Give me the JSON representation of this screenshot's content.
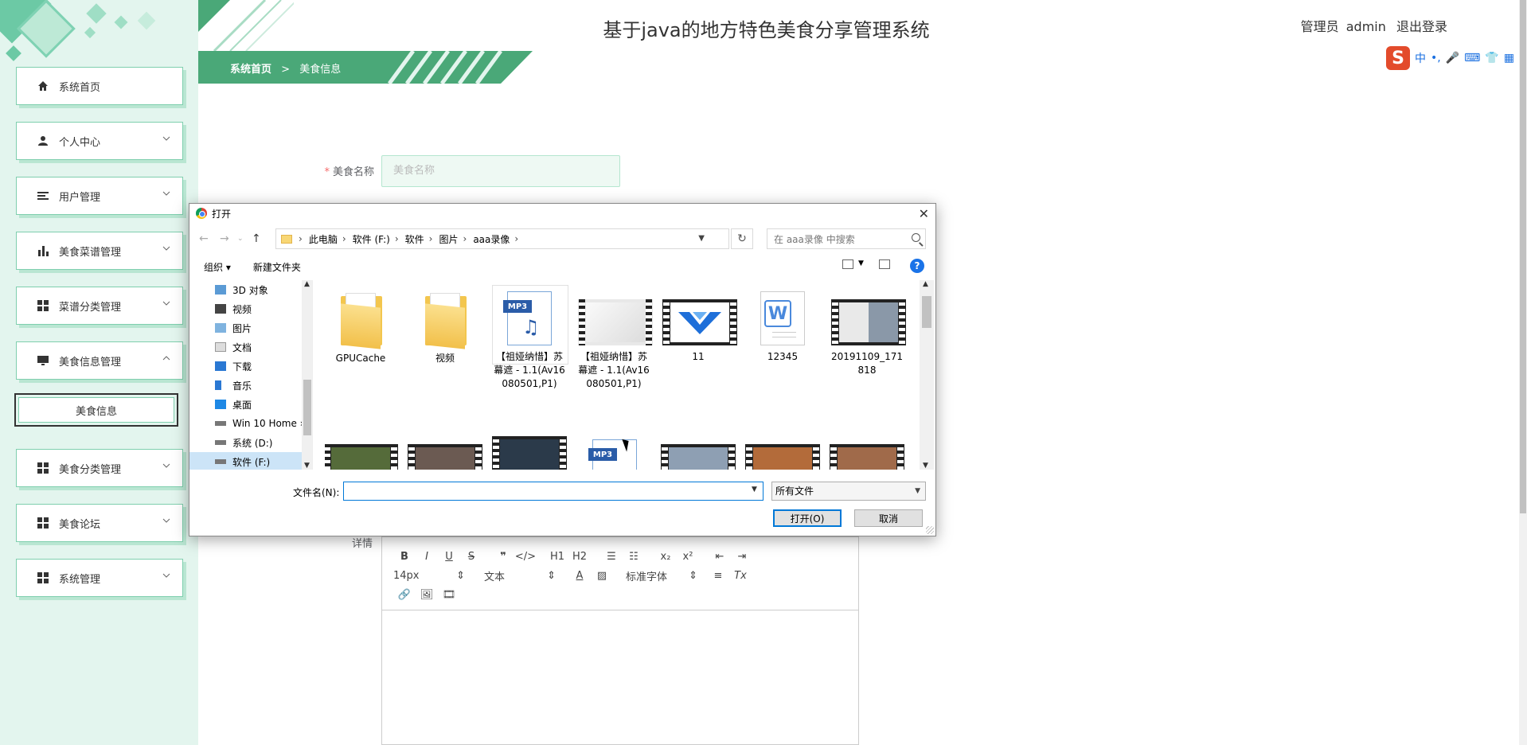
{
  "header": {
    "title": "基于java的地方特色美食分享管理系统",
    "user_role": "管理员",
    "user_name": "admin",
    "logout": "退出登录"
  },
  "breadcrumb": {
    "home": "系统首页",
    "separator": ">",
    "current": "美食信息"
  },
  "sidebar": {
    "items": [
      {
        "label": "系统首页",
        "icon": "home-icon"
      },
      {
        "label": "个人中心",
        "icon": "person-icon"
      },
      {
        "label": "用户管理",
        "icon": "list-icon"
      },
      {
        "label": "美食菜谱管理",
        "icon": "bar-chart-icon"
      },
      {
        "label": "菜谱分类管理",
        "icon": "grid-icon"
      },
      {
        "label": "美食信息管理",
        "icon": "monitor-icon"
      },
      {
        "label": "美食分类管理",
        "icon": "grid-icon"
      },
      {
        "label": "美食论坛",
        "icon": "grid-icon"
      },
      {
        "label": "系统管理",
        "icon": "grid-icon"
      }
    ],
    "sub_item": "美食信息"
  },
  "form": {
    "food_name_label": "美食名称",
    "food_name_placeholder": "美食名称",
    "detail_label": "详情"
  },
  "editor": {
    "font_size": "14px",
    "block_type": "文本",
    "font_family": "标准字体",
    "h1": "H1",
    "h2": "H2"
  },
  "ime": {
    "mode": "中"
  },
  "dialog": {
    "title": "打开",
    "path": [
      "此电脑",
      "软件 (F:)",
      "软件",
      "图片",
      "aaa录像"
    ],
    "search_placeholder": "在 aaa录像 中搜索",
    "organize": "组织",
    "new_folder": "新建文件夹",
    "nav_items": [
      {
        "label": "3D 对象",
        "icon": "cube-icon"
      },
      {
        "label": "视频",
        "icon": "video-icon"
      },
      {
        "label": "图片",
        "icon": "picture-icon"
      },
      {
        "label": "文档",
        "icon": "document-icon"
      },
      {
        "label": "下载",
        "icon": "download-icon"
      },
      {
        "label": "音乐",
        "icon": "music-icon"
      },
      {
        "label": "桌面",
        "icon": "desktop-icon"
      },
      {
        "label": "Win 10 Home ›",
        "icon": "drive-icon"
      },
      {
        "label": "系统 (D:)",
        "icon": "drive-icon"
      },
      {
        "label": "软件 (F:)",
        "icon": "drive-icon"
      }
    ],
    "files": [
      {
        "name": "GPUCache",
        "type": "folder"
      },
      {
        "name": "视频",
        "type": "folder"
      },
      {
        "name": "【祖娅纳惜】苏幕遮 - 1.1(Av16080501,P1)",
        "type": "mp3"
      },
      {
        "name": "【祖娅纳惜】苏幕遮 - 1.1(Av16080501,P1)",
        "type": "video"
      },
      {
        "name": "11",
        "type": "video"
      },
      {
        "name": "12345",
        "type": "doc"
      },
      {
        "name": "20191109_171818",
        "type": "video"
      }
    ],
    "filename_label": "文件名(N):",
    "filename_value": "",
    "filetype": "所有文件",
    "open_button": "打开(O)",
    "cancel_button": "取消"
  },
  "colors": {
    "sidebar_bg": "#e3f5ee",
    "accent_green": "#4aa878",
    "dialog_accent": "#0078d7"
  }
}
